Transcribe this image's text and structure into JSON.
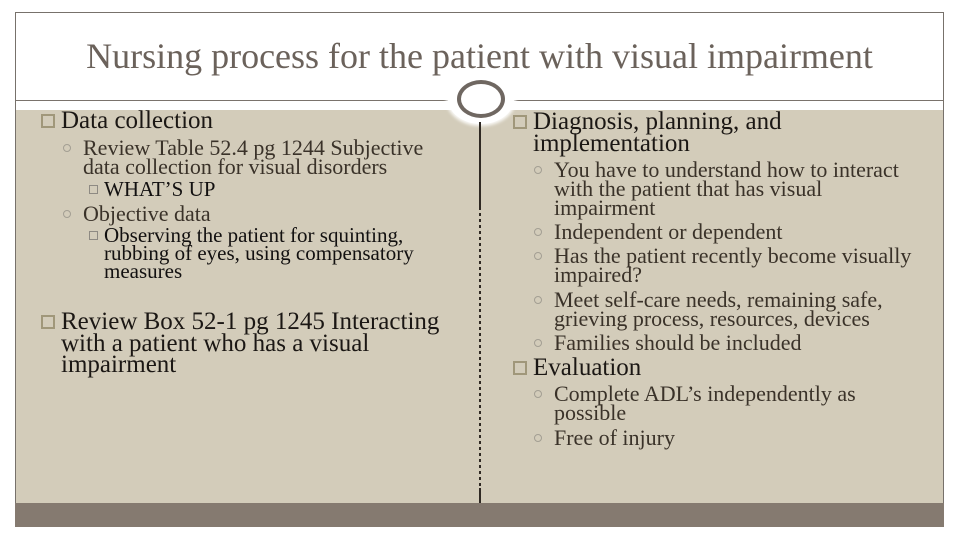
{
  "slide": {
    "title": "Nursing process for the patient with visual impairment",
    "left_column": {
      "items": [
        {
          "level": 1,
          "text": "Data collection"
        },
        {
          "level": 2,
          "text": "Review Table 52.4 pg 1244 Subjective data collection for visual disorders"
        },
        {
          "level": 3,
          "text": "WHAT’S UP"
        },
        {
          "level": 2,
          "text": "Objective data"
        },
        {
          "level": 3,
          "text": "Observing the patient for squinting, rubbing of eyes, using compensatory measures"
        },
        {
          "level": 1,
          "text": "Review Box 52-1 pg 1245 Interacting with a patient who has a visual impairment"
        }
      ]
    },
    "right_column": {
      "items": [
        {
          "level": 1,
          "text": "Diagnosis, planning, and implementation"
        },
        {
          "level": 2,
          "text": "You have to understand how to interact with the patient that has visual impairment"
        },
        {
          "level": 2,
          "text": "Independent or dependent"
        },
        {
          "level": 2,
          "text": "Has the patient recently become visually impaired?"
        },
        {
          "level": 2,
          "text": "Meet self-care needs, remaining safe, grieving process, resources, devices"
        },
        {
          "level": 2,
          "text": "Families should be included"
        },
        {
          "level": 1,
          "text": "Evaluation"
        },
        {
          "level": 2,
          "text": "Complete ADL’s independently as possible"
        },
        {
          "level": 2,
          "text": "Free of injury"
        }
      ]
    },
    "bullet_icons": {
      "level_1": "square-outline-bullet",
      "level_2": "circle-outline-bullet",
      "level_3": "small-square-outline-bullet"
    },
    "colors": {
      "title": "#6b625b",
      "content_band": "#d3ccba",
      "footer_band": "#857a70",
      "bullet_level_1": "#a0977a",
      "ornament_ring": "#6f6761",
      "divider": "#2f2923"
    }
  }
}
